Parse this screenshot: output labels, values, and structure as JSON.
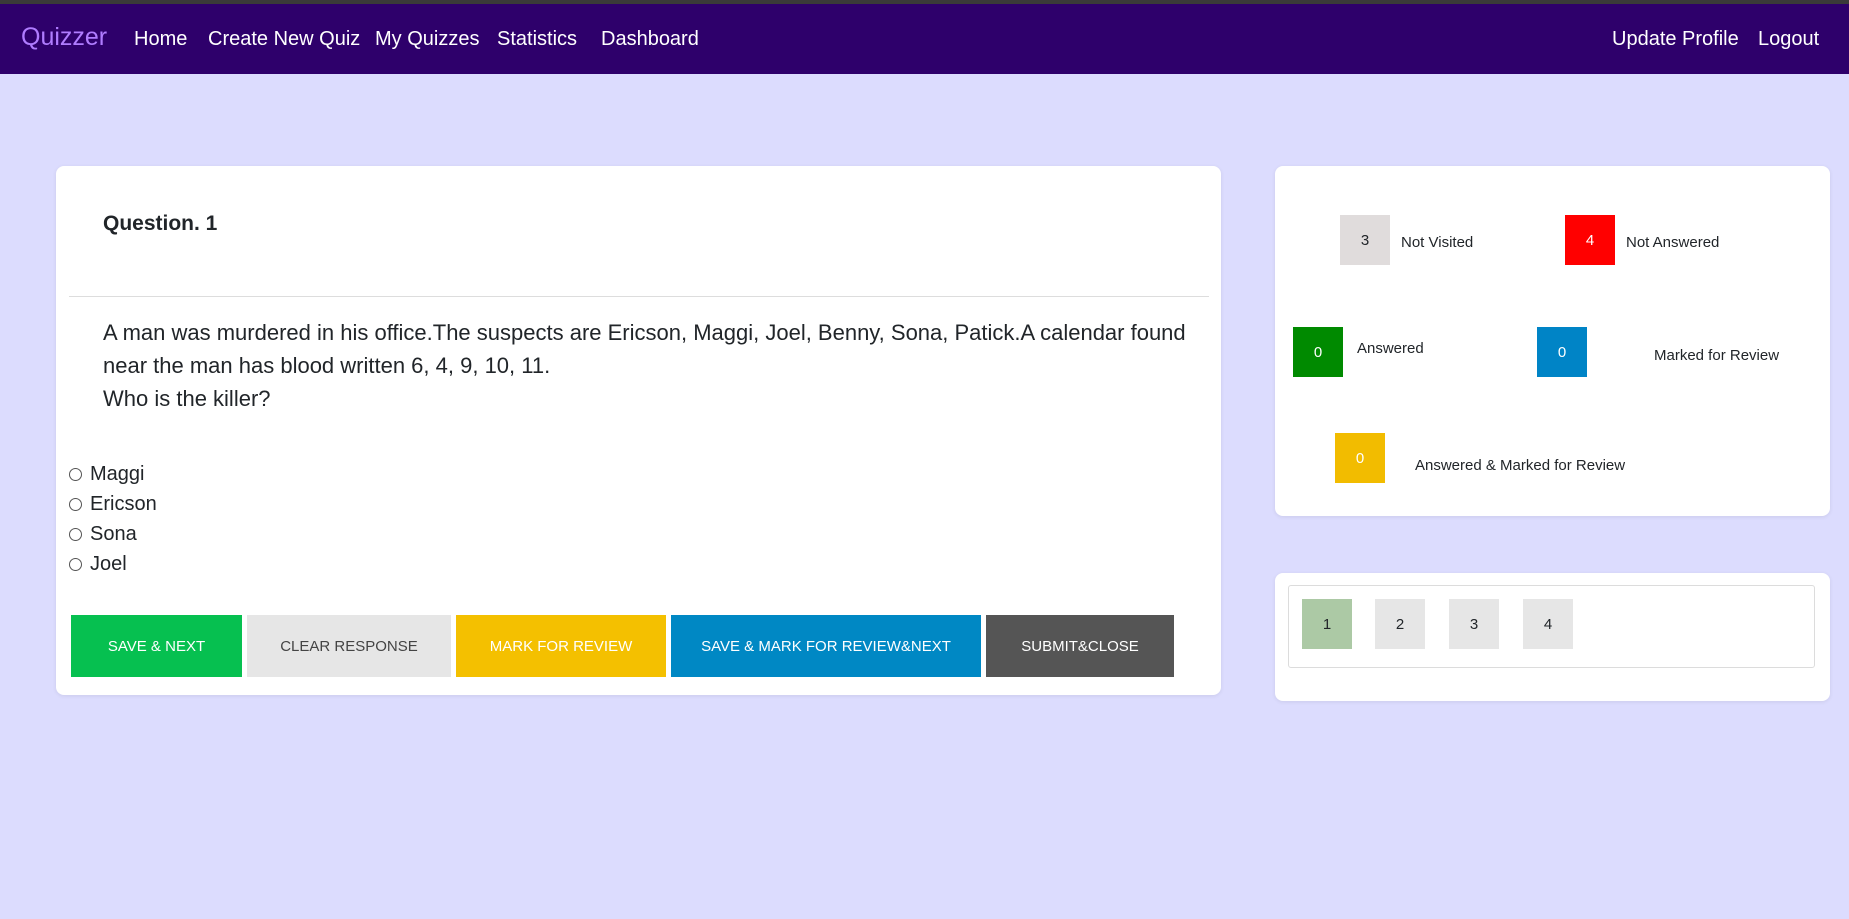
{
  "navbar": {
    "brand": "Quizzer",
    "links": [
      "Home",
      "Create New Quiz",
      "My Quizzes",
      "Statistics",
      "Dashboard"
    ],
    "right_links": [
      "Update Profile",
      "Logout"
    ],
    "bg_color": "#2e006b",
    "brand_color": "#b07cff"
  },
  "question": {
    "title": "Question. 1",
    "text_lines": [
      "A man was murdered in his office.The suspects are Ericson, Maggi, Joel, Benny, Sona, Patick.A calendar found",
      "near the man has blood written 6, 4, 9, 10, 11.",
      "Who is the killer?"
    ],
    "options": [
      "Maggi",
      "Ericson",
      "Sona",
      "Joel"
    ]
  },
  "buttons": {
    "save_next": "SAVE & NEXT",
    "clear_response": "CLEAR RESPONSE",
    "mark_review": "MARK FOR REVIEW",
    "save_mark_next": "SAVE & MARK FOR REVIEW&NEXT",
    "submit_close": "SUBMIT&CLOSE"
  },
  "legend": {
    "not_visited": {
      "count": "3",
      "label": "Not Visited",
      "color": "#e0dcdc"
    },
    "not_answered": {
      "count": "4",
      "label": "Not Answered",
      "color": "#ff0000"
    },
    "answered": {
      "count": "0",
      "label": "Answered",
      "color": "#008a00"
    },
    "marked_review": {
      "count": "0",
      "label": "Marked for Review",
      "color": "#0084c6"
    },
    "answered_marked": {
      "count": "0",
      "label": "Answered & Marked for Review",
      "color": "#f2bc00"
    }
  },
  "pages": {
    "items": [
      "1",
      "2",
      "3",
      "4"
    ],
    "current": "1",
    "current_color": "#acc9a5"
  },
  "colors": {
    "background": "#dcdcfe",
    "save_next": "#06c050",
    "clear_response": "#e6e6e6",
    "mark_review": "#f4c000",
    "save_mark_next": "#0088c4",
    "submit_close": "#555555"
  }
}
